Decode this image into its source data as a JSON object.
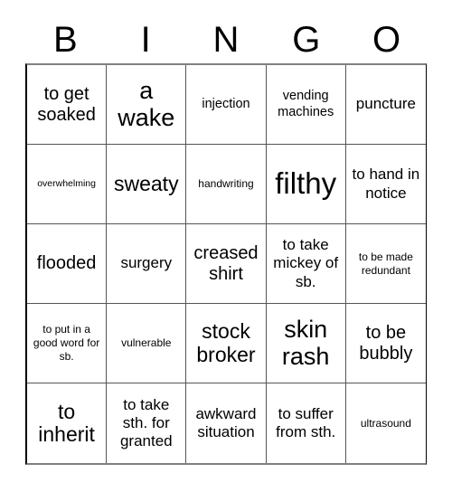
{
  "card": {
    "title": "BINGO",
    "background_color": "#ffffff",
    "text_color": "#000000",
    "border_color": "#555555",
    "columns": 5,
    "rows": 5
  },
  "header": {
    "letters": [
      "B",
      "I",
      "N",
      "G",
      "O"
    ]
  },
  "cells": [
    {
      "text": "to get soaked",
      "size": "l",
      "row": 1,
      "col": 1
    },
    {
      "text": "a wake",
      "size": "xxl",
      "row": 1,
      "col": 2
    },
    {
      "text": "injection",
      "size": "s",
      "row": 1,
      "col": 3
    },
    {
      "text": "vending machines",
      "size": "s",
      "row": 1,
      "col": 4
    },
    {
      "text": "puncture",
      "size": "m",
      "row": 1,
      "col": 5
    },
    {
      "text": "overwhelming",
      "size": "xxs",
      "row": 2,
      "col": 1
    },
    {
      "text": "sweaty",
      "size": "xl",
      "row": 2,
      "col": 2
    },
    {
      "text": "handwriting",
      "size": "xs",
      "row": 2,
      "col": 3
    },
    {
      "text": "filthy",
      "size": "huge",
      "row": 2,
      "col": 4
    },
    {
      "text": "to hand in notice",
      "size": "m",
      "row": 2,
      "col": 5
    },
    {
      "text": "flooded",
      "size": "l",
      "row": 3,
      "col": 1
    },
    {
      "text": "surgery",
      "size": "m",
      "row": 3,
      "col": 2
    },
    {
      "text": "creased shirt",
      "size": "l",
      "row": 3,
      "col": 3
    },
    {
      "text": "to take mickey of sb.",
      "size": "m",
      "row": 3,
      "col": 4
    },
    {
      "text": "to be made redundant",
      "size": "xs",
      "row": 3,
      "col": 5
    },
    {
      "text": "to put in a good word for sb.",
      "size": "xs",
      "row": 4,
      "col": 1
    },
    {
      "text": "vulnerable",
      "size": "xs",
      "row": 4,
      "col": 2
    },
    {
      "text": "stock broker",
      "size": "xl",
      "row": 4,
      "col": 3
    },
    {
      "text": "skin rash",
      "size": "xxl",
      "row": 4,
      "col": 4
    },
    {
      "text": "to be bubbly",
      "size": "l",
      "row": 4,
      "col": 5
    },
    {
      "text": "to inherit",
      "size": "xl",
      "row": 5,
      "col": 1
    },
    {
      "text": "to take sth. for granted",
      "size": "m",
      "row": 5,
      "col": 2
    },
    {
      "text": "awkward situation",
      "size": "m",
      "row": 5,
      "col": 3
    },
    {
      "text": "to suffer from sth.",
      "size": "m",
      "row": 5,
      "col": 4
    },
    {
      "text": "ultrasound",
      "size": "xs",
      "row": 5,
      "col": 5
    }
  ]
}
